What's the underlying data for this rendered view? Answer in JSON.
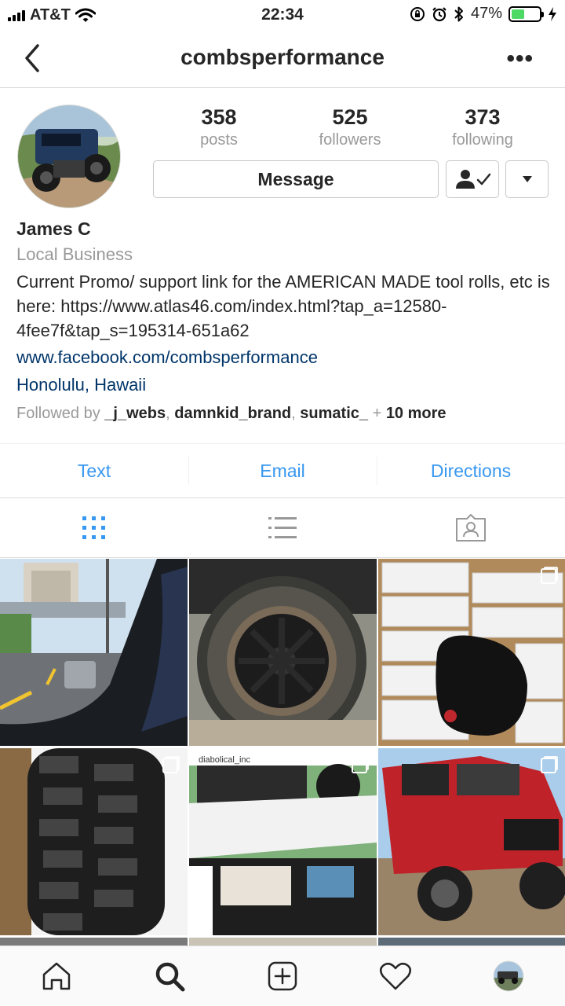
{
  "status": {
    "carrier": "AT&T",
    "time": "22:34",
    "battery": "47%",
    "battery_level": 0.47
  },
  "header": {
    "username": "combsperformance",
    "more_label": "•••"
  },
  "stats": {
    "posts_count": "358",
    "posts_label": "posts",
    "followers_count": "525",
    "followers_label": "followers",
    "following_count": "373",
    "following_label": "following"
  },
  "actions": {
    "message_label": "Message"
  },
  "bio": {
    "name": "James C",
    "category": "Local Business",
    "description": "Current Promo/ support link for the AMERICAN MADE tool rolls, etc is here: https://www.atlas46.com/index.html?tap_a=12580-4fee7f&tap_s=195314-651a62",
    "website": "www.facebook.com/combsperformance",
    "location": "Honolulu, Hawaii",
    "followed_prefix": "Followed by",
    "followed_users": [
      "_j_webs",
      "damnkid_brand",
      "sumatic_"
    ],
    "followed_more": "10 more",
    "sep": ", ",
    "plus": "+"
  },
  "contact": {
    "text_label": "Text",
    "email_label": "Email",
    "directions_label": "Directions"
  },
  "grid": {
    "repost_user": "diabolical_inc"
  },
  "icons": {
    "back": "chevron-left-icon",
    "grid": "grid-icon",
    "list": "list-icon",
    "tagged": "tagged-icon",
    "home": "home-icon",
    "search": "search-icon",
    "add": "add-icon",
    "activity": "heart-icon",
    "profile": "profile-avatar"
  },
  "colors": {
    "link": "#003569",
    "accent": "#3897f0",
    "muted": "#999999"
  }
}
